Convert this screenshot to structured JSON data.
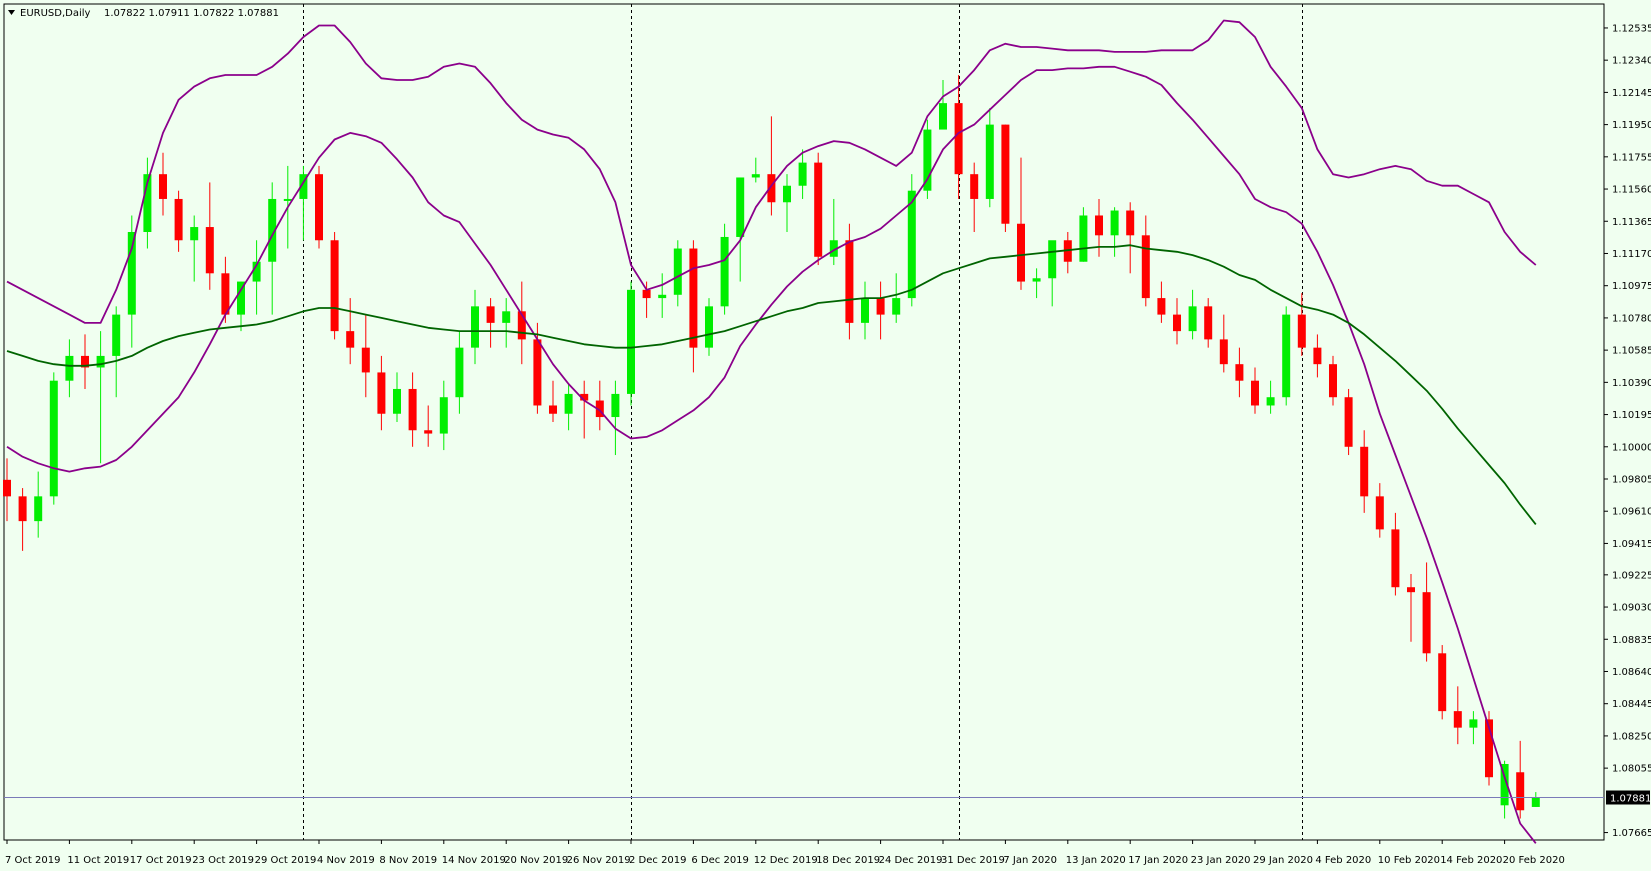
{
  "header": {
    "symbol": "EURUSD,Daily",
    "ohlc": "1.07822 1.07911 1.07822 1.07881",
    "menu_icon": "triangle-down-icon"
  },
  "colors": {
    "background": "#f0fff0",
    "bull": "#00ee00",
    "bear": "#ff0000",
    "wick": "#000000",
    "band": "#8b008b",
    "middle": "#006400",
    "price_line": "#7a7ab8",
    "separator": "#000000"
  },
  "chart_data": {
    "type": "candlestick",
    "symbol": "EURUSD",
    "timeframe": "Daily",
    "ylim": [
      1.0762,
      1.1268
    ],
    "y_ticks": [
      "1.12535",
      "1.12340",
      "1.12145",
      "1.11950",
      "1.11755",
      "1.11560",
      "1.11365",
      "1.11170",
      "1.10975",
      "1.10780",
      "1.10585",
      "1.10390",
      "1.10195",
      "1.10000",
      "1.09805",
      "1.09610",
      "1.09415",
      "1.09225",
      "1.09030",
      "1.08835",
      "1.08640",
      "1.08445",
      "1.08250",
      "1.08055",
      "1.07881",
      "1.07665"
    ],
    "x_labels": [
      "7 Oct 2019",
      "11 Oct 2019",
      "17 Oct 2019",
      "23 Oct 2019",
      "29 Oct 2019",
      "4 Nov 2019",
      "8 Nov 2019",
      "14 Nov 2019",
      "20 Nov 2019",
      "26 Nov 2019",
      "2 Dec 2019",
      "6 Dec 2019",
      "12 Dec 2019",
      "18 Dec 2019",
      "24 Dec 2019",
      "31 Dec 2019",
      "7 Jan 2020",
      "13 Jan 2020",
      "17 Jan 2020",
      "23 Jan 2020",
      "29 Jan 2020",
      "4 Feb 2020",
      "10 Feb 2020",
      "14 Feb 2020",
      "20 Feb 2020"
    ],
    "x_label_bars": [
      0,
      4,
      8,
      12,
      16,
      20,
      24,
      28,
      32,
      36,
      40,
      44,
      48,
      52,
      56,
      60,
      64,
      68,
      72,
      76,
      80,
      84,
      88,
      92,
      96
    ],
    "separator_bars": [
      19,
      40,
      61,
      83
    ],
    "current_price": 1.07881,
    "current_price_label": "1.07881",
    "candles": [
      [
        1.098,
        1.0993,
        1.0955,
        1.097
      ],
      [
        1.097,
        1.0975,
        1.0937,
        1.0955
      ],
      [
        1.0955,
        1.0985,
        1.0945,
        1.097
      ],
      [
        1.097,
        1.1045,
        1.0965,
        1.104
      ],
      [
        1.104,
        1.1065,
        1.103,
        1.1055
      ],
      [
        1.1055,
        1.1068,
        1.1035,
        1.1048
      ],
      [
        1.1048,
        1.107,
        1.099,
        1.1055
      ],
      [
        1.1055,
        1.1085,
        1.103,
        1.108
      ],
      [
        1.108,
        1.114,
        1.106,
        1.113
      ],
      [
        1.113,
        1.1175,
        1.112,
        1.1165
      ],
      [
        1.1165,
        1.1178,
        1.114,
        1.115
      ],
      [
        1.115,
        1.1155,
        1.1118,
        1.1125
      ],
      [
        1.1125,
        1.114,
        1.11,
        1.1133
      ],
      [
        1.1133,
        1.116,
        1.1095,
        1.1105
      ],
      [
        1.1105,
        1.1115,
        1.1075,
        1.108
      ],
      [
        1.108,
        1.11,
        1.107,
        1.11
      ],
      [
        1.11,
        1.1125,
        1.108,
        1.1112
      ],
      [
        1.1112,
        1.116,
        1.108,
        1.115
      ],
      [
        1.115,
        1.117,
        1.112,
        1.115
      ],
      [
        1.115,
        1.117,
        1.1125,
        1.1165
      ],
      [
        1.1165,
        1.117,
        1.112,
        1.1125
      ],
      [
        1.1125,
        1.113,
        1.1065,
        1.107
      ],
      [
        1.107,
        1.109,
        1.105,
        1.106
      ],
      [
        1.106,
        1.108,
        1.103,
        1.1045
      ],
      [
        1.1045,
        1.1055,
        1.101,
        1.102
      ],
      [
        1.102,
        1.1045,
        1.1015,
        1.1035
      ],
      [
        1.1035,
        1.1045,
        1.1,
        1.101
      ],
      [
        1.101,
        1.1025,
        1.1,
        1.1008
      ],
      [
        1.1008,
        1.104,
        1.0998,
        1.103
      ],
      [
        1.103,
        1.107,
        1.102,
        1.106
      ],
      [
        1.106,
        1.1095,
        1.105,
        1.1085
      ],
      [
        1.1085,
        1.109,
        1.106,
        1.1075
      ],
      [
        1.1075,
        1.109,
        1.106,
        1.1082
      ],
      [
        1.1082,
        1.11,
        1.105,
        1.1065
      ],
      [
        1.1065,
        1.1075,
        1.102,
        1.1025
      ],
      [
        1.1025,
        1.104,
        1.1015,
        1.102
      ],
      [
        1.102,
        1.1038,
        1.101,
        1.1032
      ],
      [
        1.1032,
        1.104,
        1.1005,
        1.1028
      ],
      [
        1.1028,
        1.104,
        1.101,
        1.1018
      ],
      [
        1.1018,
        1.104,
        1.0995,
        1.1032
      ],
      [
        1.1032,
        1.11,
        1.1025,
        1.1095
      ],
      [
        1.1095,
        1.11,
        1.1078,
        1.109
      ],
      [
        1.109,
        1.1105,
        1.1078,
        1.1092
      ],
      [
        1.1092,
        1.1125,
        1.1085,
        1.112
      ],
      [
        1.112,
        1.1125,
        1.1045,
        1.106
      ],
      [
        1.106,
        1.109,
        1.1055,
        1.1085
      ],
      [
        1.1085,
        1.1135,
        1.108,
        1.1127
      ],
      [
        1.1127,
        1.1163,
        1.11,
        1.1163
      ],
      [
        1.1163,
        1.1175,
        1.116,
        1.1165
      ],
      [
        1.1165,
        1.12,
        1.114,
        1.1148
      ],
      [
        1.1148,
        1.1165,
        1.113,
        1.1158
      ],
      [
        1.1158,
        1.118,
        1.115,
        1.1172
      ],
      [
        1.1172,
        1.1178,
        1.111,
        1.1115
      ],
      [
        1.1115,
        1.115,
        1.111,
        1.1125
      ],
      [
        1.1125,
        1.1135,
        1.1065,
        1.1075
      ],
      [
        1.1075,
        1.11,
        1.1065,
        1.109
      ],
      [
        1.109,
        1.11,
        1.1065,
        1.108
      ],
      [
        1.108,
        1.1105,
        1.1075,
        1.109
      ],
      [
        1.109,
        1.1165,
        1.1085,
        1.1155
      ],
      [
        1.1155,
        1.1198,
        1.115,
        1.1192
      ],
      [
        1.1192,
        1.1222,
        1.1195,
        1.1208
      ],
      [
        1.1208,
        1.1225,
        1.115,
        1.1165
      ],
      [
        1.1165,
        1.1172,
        1.113,
        1.115
      ],
      [
        1.115,
        1.1205,
        1.1145,
        1.1195
      ],
      [
        1.1195,
        1.1195,
        1.113,
        1.1135
      ],
      [
        1.1135,
        1.1175,
        1.1095,
        1.11
      ],
      [
        1.11,
        1.1108,
        1.109,
        1.1102
      ],
      [
        1.1102,
        1.1115,
        1.1085,
        1.1125
      ],
      [
        1.1125,
        1.113,
        1.1105,
        1.1112
      ],
      [
        1.1112,
        1.1145,
        1.1112,
        1.114
      ],
      [
        1.114,
        1.115,
        1.1115,
        1.1128
      ],
      [
        1.1128,
        1.1145,
        1.1115,
        1.1143
      ],
      [
        1.1143,
        1.1148,
        1.1105,
        1.1128
      ],
      [
        1.1128,
        1.114,
        1.1085,
        1.109
      ],
      [
        1.109,
        1.11,
        1.1075,
        1.108
      ],
      [
        1.108,
        1.109,
        1.1062,
        1.107
      ],
      [
        1.107,
        1.1095,
        1.1065,
        1.1085
      ],
      [
        1.1085,
        1.109,
        1.106,
        1.1065
      ],
      [
        1.1065,
        1.108,
        1.1045,
        1.105
      ],
      [
        1.105,
        1.106,
        1.103,
        1.104
      ],
      [
        1.104,
        1.1048,
        1.102,
        1.1025
      ],
      [
        1.1025,
        1.104,
        1.102,
        1.103
      ],
      [
        1.103,
        1.1085,
        1.1025,
        1.108
      ],
      [
        1.108,
        1.1093,
        1.1055,
        1.106
      ],
      [
        1.106,
        1.1068,
        1.1042,
        1.105
      ],
      [
        1.105,
        1.1055,
        1.1025,
        1.103
      ],
      [
        1.103,
        1.1035,
        1.0995,
        1.1
      ],
      [
        1.1,
        1.101,
        1.096,
        1.097
      ],
      [
        1.097,
        1.0978,
        1.0945,
        1.095
      ],
      [
        1.095,
        1.096,
        1.091,
        1.0915
      ],
      [
        1.0915,
        1.0923,
        1.0882,
        1.0912
      ],
      [
        1.0912,
        1.093,
        1.087,
        1.0875
      ],
      [
        1.0875,
        1.088,
        1.0835,
        1.084
      ],
      [
        1.084,
        1.0855,
        1.082,
        1.083
      ],
      [
        1.083,
        1.084,
        1.082,
        1.0835
      ],
      [
        1.0835,
        1.084,
        1.0795,
        1.08
      ],
      [
        1.0783,
        1.081,
        1.0775,
        1.0808
      ],
      [
        1.0803,
        1.0822,
        1.0775,
        1.078
      ],
      [
        1.0782,
        1.0791,
        1.0782,
        1.0788
      ]
    ],
    "middle_band": [
      1.1058,
      1.1055,
      1.1052,
      1.105,
      1.1049,
      1.1049,
      1.105,
      1.1052,
      1.1055,
      1.106,
      1.1064,
      1.1067,
      1.1069,
      1.1071,
      1.1072,
      1.1073,
      1.1074,
      1.1076,
      1.1079,
      1.1082,
      1.1084,
      1.1084,
      1.1082,
      1.108,
      1.1078,
      1.1076,
      1.1074,
      1.1072,
      1.1071,
      1.107,
      1.107,
      1.107,
      1.107,
      1.1069,
      1.1068,
      1.1066,
      1.1064,
      1.1062,
      1.1061,
      1.106,
      1.106,
      1.1061,
      1.1062,
      1.1064,
      1.1066,
      1.1068,
      1.107,
      1.1073,
      1.1076,
      1.1079,
      1.1082,
      1.1084,
      1.1087,
      1.1088,
      1.1089,
      1.109,
      1.109,
      1.1092,
      1.1095,
      1.11,
      1.1105,
      1.1108,
      1.1111,
      1.1114,
      1.1115,
      1.1116,
      1.1117,
      1.1118,
      1.1119,
      1.112,
      1.1121,
      1.1121,
      1.1122,
      1.112,
      1.1119,
      1.1118,
      1.1116,
      1.1113,
      1.1109,
      1.1104,
      1.1101,
      1.1095,
      1.109,
      1.1085,
      1.1083,
      1.108,
      1.1075,
      1.1068,
      1.106,
      1.1052,
      1.1043,
      1.1034,
      1.1023,
      1.1011,
      1.1,
      1.0989,
      1.0978,
      1.0965,
      1.0953
    ],
    "upper_band": [
      1.11,
      1.1095,
      1.109,
      1.1085,
      1.108,
      1.1075,
      1.1075,
      1.1095,
      1.112,
      1.116,
      1.119,
      1.121,
      1.1218,
      1.1223,
      1.1225,
      1.1225,
      1.1225,
      1.123,
      1.1238,
      1.1248,
      1.1255,
      1.1255,
      1.1245,
      1.1232,
      1.1223,
      1.1222,
      1.1222,
      1.1224,
      1.123,
      1.1232,
      1.123,
      1.122,
      1.1208,
      1.1198,
      1.1192,
      1.1189,
      1.1187,
      1.118,
      1.1168,
      1.1148,
      1.111,
      1.1095,
      1.1098,
      1.1103,
      1.1108,
      1.111,
      1.1113,
      1.1125,
      1.1145,
      1.1158,
      1.117,
      1.1178,
      1.1182,
      1.1185,
      1.1184,
      1.118,
      1.1175,
      1.117,
      1.1178,
      1.12,
      1.1212,
      1.1218,
      1.1228,
      1.124,
      1.1244,
      1.1242,
      1.1242,
      1.1241,
      1.124,
      1.124,
      1.124,
      1.1239,
      1.1239,
      1.1239,
      1.124,
      1.124,
      1.124,
      1.1246,
      1.1258,
      1.1257,
      1.1248,
      1.123,
      1.1218,
      1.1205,
      1.118,
      1.1165,
      1.1163,
      1.1165,
      1.1168,
      1.117,
      1.1168,
      1.1161,
      1.1158,
      1.1158,
      1.1153,
      1.1148,
      1.113,
      1.1118,
      1.111
    ],
    "lower_band": [
      1.1,
      1.0994,
      1.099,
      1.0987,
      1.0985,
      1.0987,
      1.0988,
      1.0992,
      1.1,
      1.101,
      1.102,
      1.103,
      1.1045,
      1.1062,
      1.108,
      1.1095,
      1.111,
      1.1128,
      1.1145,
      1.116,
      1.1175,
      1.1186,
      1.119,
      1.1188,
      1.1184,
      1.1174,
      1.1163,
      1.1148,
      1.114,
      1.1136,
      1.1123,
      1.111,
      1.1095,
      1.108,
      1.1065,
      1.105,
      1.1038,
      1.1028,
      1.1022,
      1.1011,
      1.1005,
      1.1006,
      1.101,
      1.1016,
      1.1022,
      1.103,
      1.1042,
      1.1061,
      1.1074,
      1.1086,
      1.1097,
      1.1106,
      1.1113,
      1.1119,
      1.1124,
      1.1127,
      1.1132,
      1.114,
      1.1148,
      1.1162,
      1.118,
      1.119,
      1.1195,
      1.1204,
      1.1213,
      1.1222,
      1.1228,
      1.1228,
      1.1229,
      1.1229,
      1.123,
      1.123,
      1.1227,
      1.1224,
      1.1219,
      1.1208,
      1.1198,
      1.1187,
      1.1176,
      1.1165,
      1.115,
      1.1145,
      1.1142,
      1.1135,
      1.1118,
      1.1098,
      1.1075,
      1.105,
      1.102,
      1.0995,
      1.097,
      1.0945,
      1.0918,
      1.089,
      1.086,
      1.083,
      1.08,
      1.0772,
      1.076
    ]
  }
}
